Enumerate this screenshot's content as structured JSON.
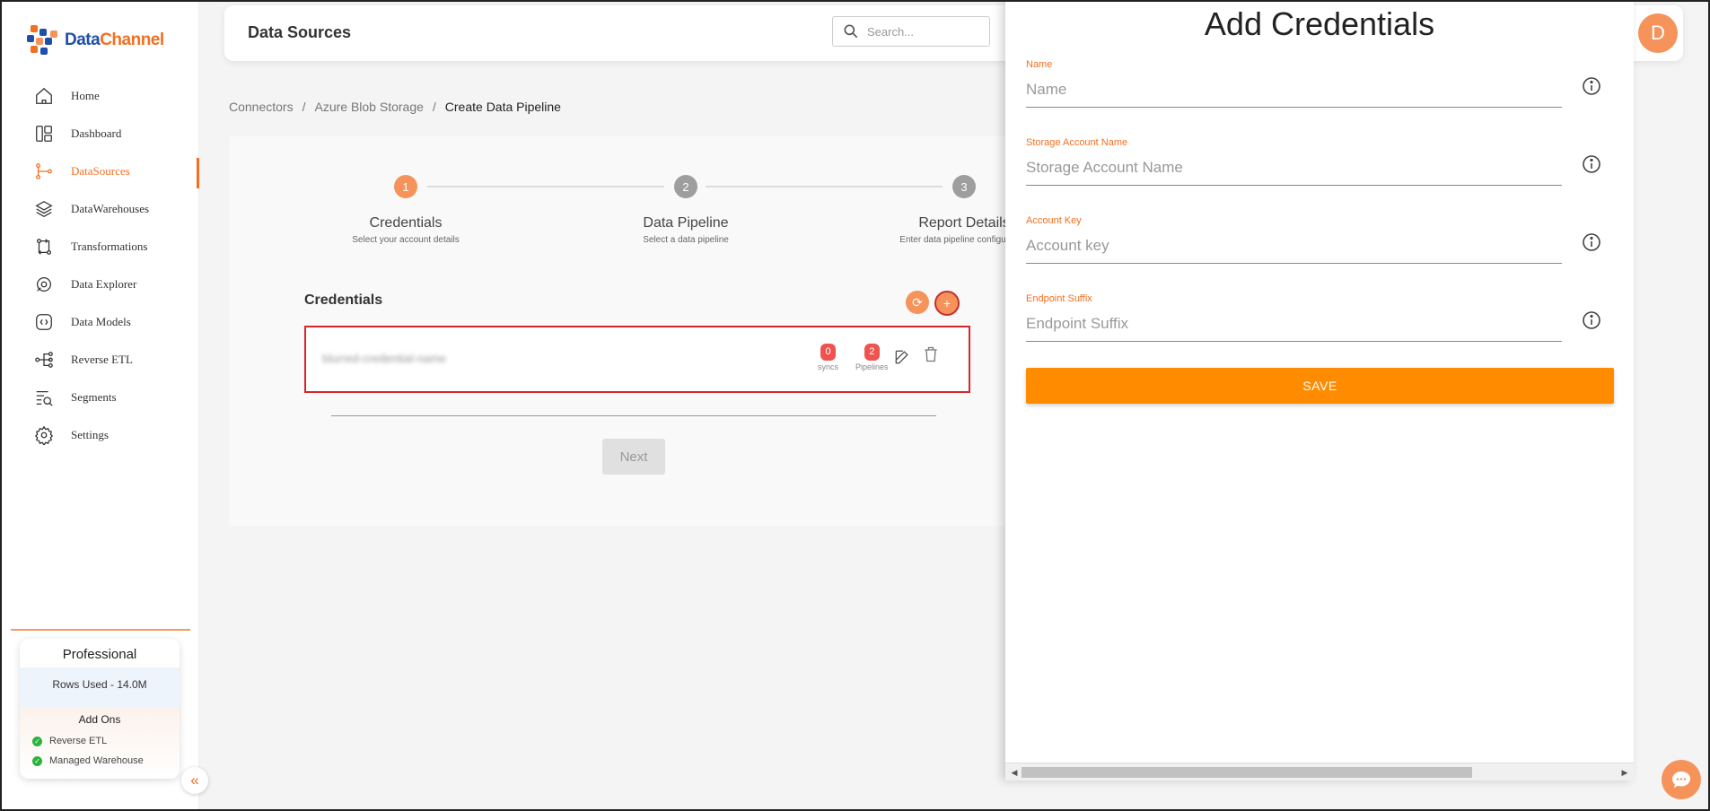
{
  "brand": {
    "part1": "Data",
    "part2": "Channel"
  },
  "sidebar": {
    "items": [
      {
        "label": "Home",
        "icon": "home-icon"
      },
      {
        "label": "Dashboard",
        "icon": "dashboard-icon"
      },
      {
        "label": "DataSources",
        "icon": "datasources-icon",
        "active": true
      },
      {
        "label": "DataWarehouses",
        "icon": "datawarehouses-icon"
      },
      {
        "label": "Transformations",
        "icon": "transformations-icon"
      },
      {
        "label": "Data Explorer",
        "icon": "data-explorer-icon"
      },
      {
        "label": "Data Models",
        "icon": "data-models-icon"
      },
      {
        "label": "Reverse ETL",
        "icon": "reverse-etl-icon"
      },
      {
        "label": "Segments",
        "icon": "segments-icon"
      },
      {
        "label": "Settings",
        "icon": "settings-icon"
      }
    ],
    "plan": {
      "name": "Professional",
      "rows_used": "Rows Used - 14.0M",
      "addons_title": "Add Ons",
      "addons": [
        "Reverse ETL",
        "Managed Warehouse"
      ]
    }
  },
  "header": {
    "title": "Data Sources",
    "search_placeholder": "Search...",
    "avatar_initial": "D"
  },
  "breadcrumb": [
    "Connectors",
    "Azure Blob Storage",
    "Create Data Pipeline"
  ],
  "stepper": {
    "steps": [
      {
        "number": "1",
        "label": "Credentials",
        "sub": "Select your account details",
        "active": true
      },
      {
        "number": "2",
        "label": "Data Pipeline",
        "sub": "Select a data pipeline"
      },
      {
        "number": "3",
        "label": "Report Details",
        "sub": "Enter data pipeline configuration"
      }
    ]
  },
  "credentials": {
    "title": "Credentials",
    "row": {
      "name": "blurred-credential-name",
      "syncs_count": "0",
      "syncs_label": "syncs",
      "pipelines_count": "2",
      "pipelines_label": "Pipelines"
    },
    "next_label": "Next"
  },
  "drawer": {
    "title": "Add Credentials",
    "fields": [
      {
        "label": "Name",
        "placeholder": "Name"
      },
      {
        "label": "Storage Account Name",
        "placeholder": "Storage Account Name"
      },
      {
        "label": "Account Key",
        "placeholder": "Account key"
      },
      {
        "label": "Endpoint Suffix",
        "placeholder": "Endpoint Suffix"
      }
    ],
    "save_label": "SAVE"
  },
  "colors": {
    "accent": "#f36f21",
    "save": "#ff8c00",
    "badge": "#ef5350",
    "highlight_border": "#d9252a"
  }
}
